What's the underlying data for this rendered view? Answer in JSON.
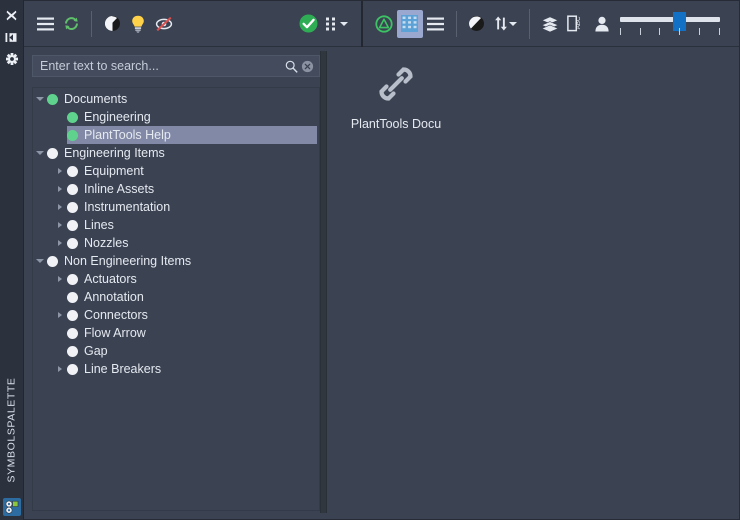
{
  "rail": {
    "icons": [
      {
        "name": "close-icon",
        "glyph": "✖"
      },
      {
        "name": "dock-pin-icon",
        "glyph": "▶|"
      },
      {
        "name": "settings-gear-icon",
        "glyph": "✳"
      }
    ],
    "label": "SYMBOLSPALETTE",
    "bottom_icon": "symbol-palette-icon"
  },
  "toolbar": {
    "groups": [
      {
        "name": "view-group",
        "items": [
          {
            "name": "menu-button",
            "icon": "hamburger-menu-icon",
            "active": false
          },
          {
            "name": "refresh-button",
            "icon": "refresh-sync-icon",
            "active": false
          },
          {
            "name": "separator",
            "icon": "separator",
            "active": false
          },
          {
            "name": "contrast-button",
            "icon": "half-circle-contrast-icon",
            "active": false
          },
          {
            "name": "highlight-button",
            "icon": "light-bulb-icon",
            "active": false
          },
          {
            "name": "hide-preview-button",
            "icon": "crossed-out-eye-icon",
            "active": false
          }
        ]
      },
      {
        "name": "status-group",
        "items": [
          {
            "name": "validate-button",
            "icon": "green-check-circle-icon",
            "active": false
          },
          {
            "name": "grid-options-button",
            "icon": "dot-grid-icon",
            "active": false,
            "has_caret": true
          }
        ]
      },
      {
        "name": "display-group",
        "items": [
          {
            "name": "shape-view-button",
            "icon": "green-circle-outline-icon",
            "active": false
          },
          {
            "name": "tile-view-button",
            "icon": "grid-tiles-icon",
            "active": true
          },
          {
            "name": "list-view-button",
            "icon": "list-lines-icon",
            "active": false
          },
          {
            "name": "separator",
            "icon": "separator",
            "active": false
          },
          {
            "name": "contrast-toggle-button",
            "icon": "half-circle-contrast-icon",
            "active": false
          },
          {
            "name": "sort-button",
            "icon": "sort-updown-icon",
            "active": false,
            "has_caret": true
          }
        ]
      },
      {
        "name": "tools-group",
        "items": [
          {
            "name": "layers-button",
            "icon": "layers-stack-icon",
            "active": false
          },
          {
            "name": "label-button",
            "icon": "abc-page-icon",
            "active": false
          },
          {
            "name": "user-button",
            "icon": "person-icon",
            "active": false
          }
        ]
      }
    ],
    "zoom_slider": {
      "name": "zoom-slider",
      "value": 4,
      "min": 1,
      "max": 6,
      "ticks": 6
    }
  },
  "search": {
    "value": "",
    "placeholder": "Enter text to search...",
    "search_icon": "search-icon",
    "clear_icon": "clear-circle-icon"
  },
  "tree": {
    "nodes": [
      {
        "label": "Documents",
        "depth": 0,
        "twist": "down",
        "bullet": "green",
        "selected": false
      },
      {
        "label": "Engineering",
        "depth": 1,
        "twist": "none",
        "bullet": "green",
        "selected": false
      },
      {
        "label": "PlantTools Help",
        "depth": 1,
        "twist": "none",
        "bullet": "green",
        "selected": true
      },
      {
        "label": "Engineering Items",
        "depth": 0,
        "twist": "down",
        "bullet": "white",
        "selected": false
      },
      {
        "label": "Equipment",
        "depth": 1,
        "twist": "right",
        "bullet": "white",
        "selected": false
      },
      {
        "label": "Inline Assets",
        "depth": 1,
        "twist": "right",
        "bullet": "white",
        "selected": false
      },
      {
        "label": "Instrumentation",
        "depth": 1,
        "twist": "right",
        "bullet": "white",
        "selected": false
      },
      {
        "label": "Lines",
        "depth": 1,
        "twist": "right",
        "bullet": "white",
        "selected": false
      },
      {
        "label": "Nozzles",
        "depth": 1,
        "twist": "right",
        "bullet": "white",
        "selected": false
      },
      {
        "label": "Non Engineering Items",
        "depth": 0,
        "twist": "down",
        "bullet": "white",
        "selected": false
      },
      {
        "label": "Actuators",
        "depth": 1,
        "twist": "right",
        "bullet": "white",
        "selected": false
      },
      {
        "label": "Annotation",
        "depth": 1,
        "twist": "none",
        "bullet": "white",
        "selected": false
      },
      {
        "label": "Connectors",
        "depth": 1,
        "twist": "right",
        "bullet": "white",
        "selected": false
      },
      {
        "label": "Flow Arrow",
        "depth": 1,
        "twist": "none",
        "bullet": "white",
        "selected": false
      },
      {
        "label": "Gap",
        "depth": 1,
        "twist": "none",
        "bullet": "white",
        "selected": false
      },
      {
        "label": "Line Breakers",
        "depth": 1,
        "twist": "right",
        "bullet": "white",
        "selected": false
      }
    ]
  },
  "content": {
    "tiles": [
      {
        "name": "document-tile",
        "label": "PlantTools Docu",
        "icon": "link-chain-icon"
      }
    ]
  },
  "colors": {
    "window_bg": "#3b4252",
    "rail_bg": "#2b323e",
    "accent_green": "#5fd38d",
    "selection": "#8289a6",
    "active_tool": "#9aa7cf",
    "slider_handle": "#1271c4"
  }
}
